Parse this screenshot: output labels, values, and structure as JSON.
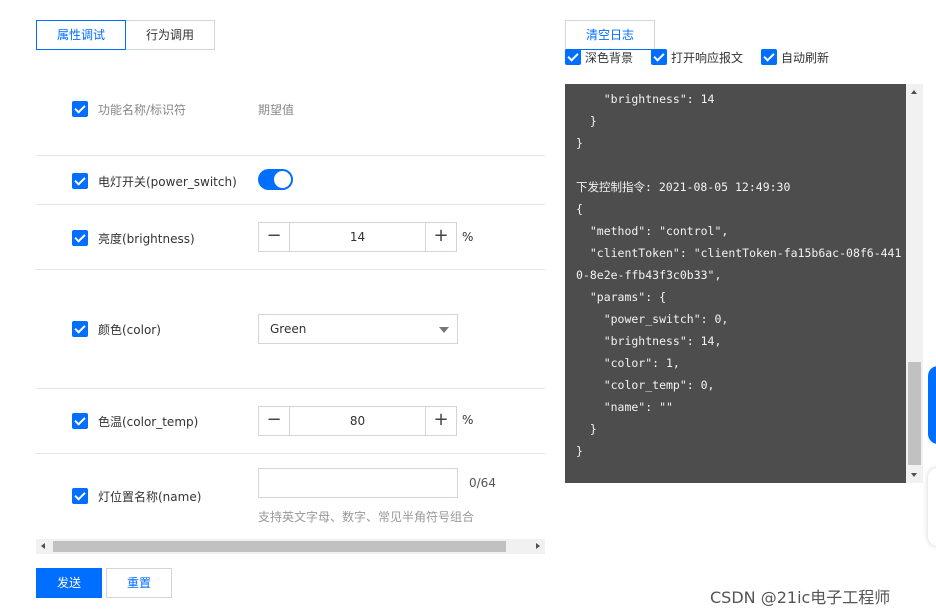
{
  "tabs": [
    {
      "label": "属性调试",
      "active": true
    },
    {
      "label": "行为调用",
      "active": false
    }
  ],
  "table": {
    "header_name": "功能名称/标识符",
    "header_value": "期望值"
  },
  "rows": {
    "power_switch": {
      "label": "电灯开关(power_switch)",
      "value": true
    },
    "brightness": {
      "label": "亮度(brightness)",
      "value": "14",
      "unit": "%"
    },
    "color": {
      "label": "颜色(color)",
      "selected": "Green"
    },
    "color_temp": {
      "label": "色温(color_temp)",
      "value": "80",
      "unit": "%"
    },
    "name": {
      "label": "灯位置名称(name)",
      "value": "",
      "counter": "0/64",
      "hint": "支持英文字母、数字、常见半角符号组合"
    }
  },
  "actions": {
    "send_label": "发送",
    "reset_label": "重置"
  },
  "log_panel": {
    "clear_label": "清空日志",
    "options": [
      {
        "label": "深色背景",
        "checked": true
      },
      {
        "label": "打开响应报文",
        "checked": true
      },
      {
        "label": "自动刷新",
        "checked": true
      }
    ],
    "text": "    \"color\": 1,\n    \"brightness\": 14\n  }\n}\n\n下发控制指令: 2021-08-05 12:49:30\n{\n  \"method\": \"control\",\n  \"clientToken\": \"clientToken-fa15b6ac-08f6-441\n0-8e2e-ffb43f3c0b33\",\n  \"params\": {\n    \"power_switch\": 0,\n    \"brightness\": 14,\n    \"color\": 1,\n    \"color_temp\": 0,\n    \"name\": \"\"\n  }\n}"
  },
  "watermark": "CSDN @21ic电子工程师",
  "colors": {
    "accent": "#006eff",
    "log_bg": "#4d4d4d",
    "border": "#cfd5de"
  },
  "icons": {
    "checkbox": "checkmark-icon",
    "minus": "minus-icon",
    "plus": "plus-icon",
    "dropdown": "chevron-down-icon"
  }
}
